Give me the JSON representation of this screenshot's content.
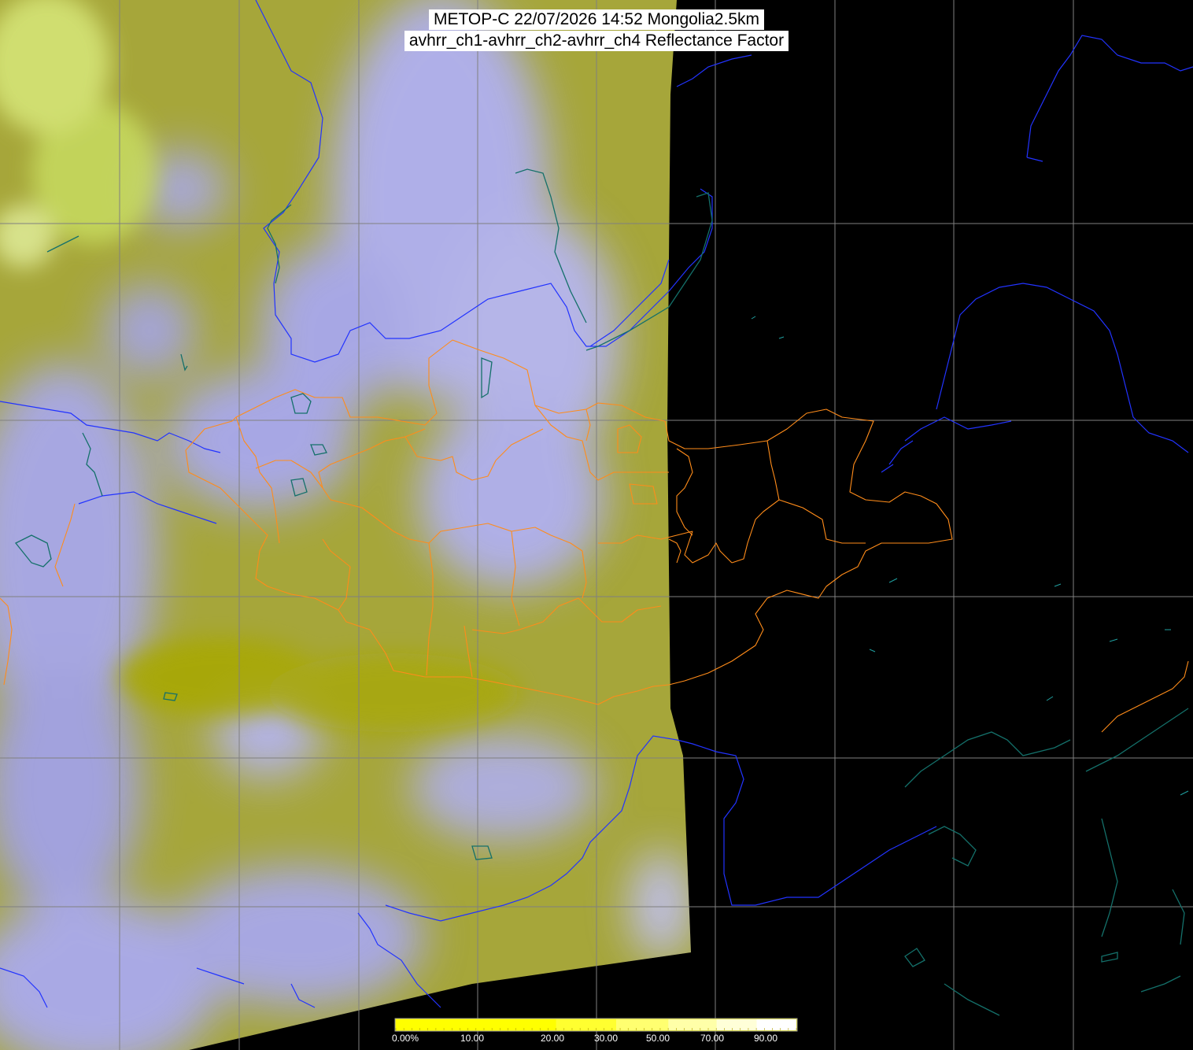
{
  "title": {
    "line1": "METOP-C 22/07/2026 14:52 Mongolia2.5km",
    "line2": "avhrr_ch1-avhrr_ch2-avhrr_ch4 Reflectance Factor"
  },
  "colorbar": {
    "colors": [
      "#ffff00",
      "#ffff30",
      "#ffff70",
      "#ffffa8",
      "#ffffd8",
      "#ffffff"
    ],
    "ticks": [
      "0.00%",
      "10.00",
      "20.00",
      "30.00",
      "50.00",
      "70.00",
      "90.00"
    ]
  },
  "colors": {
    "background": "#000000",
    "imagery_yellow": "#a8a830",
    "imagery_cloud": "#aaaaf0",
    "graticule": "#808080",
    "coastline": "#2233ff",
    "lakes": "#0f5f5f",
    "admin_borders": "#ff8c1a"
  }
}
